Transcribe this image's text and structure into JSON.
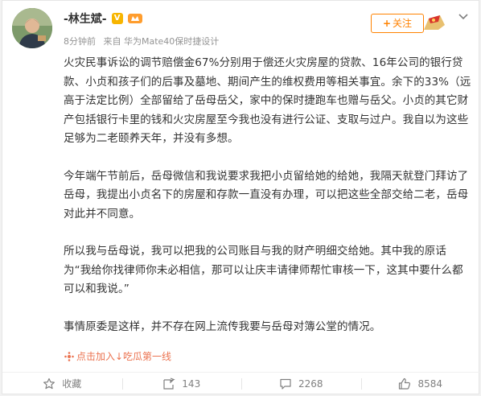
{
  "post": {
    "author_name": "-林生斌-",
    "vip_badge": "V",
    "timestamp": "8分钟前",
    "source": "来自 华为Mate40保时捷设计",
    "follow_label": "关注",
    "paragraphs": [
      "火灾民事诉讼的调节赔偿金67%分别用于偿还火灾房屋的贷款、16年公司的银行贷款、小贞和孩子们的后事及墓地、期间产生的维权费用等相关事宜。余下的33%（远高于法定比例）全部留给了岳母岳父，家中的保时捷跑车也赠与岳父。小贞的其它财产包括银行卡里的钱和火灾房屋至今我也没有进行公证、支取与过户。我自以为这些足够为二老颐养天年，并没有多想。",
      "今年端午节前后，岳母微信和我说要求我把小贞留给她的给她，我隔天就登门拜访了岳母，我提出小贞名下的房屋和存款一直没有办理，可以把这些全部交给二老，岳母对此并不同意。",
      "所以我与岳母说，我可以把我的公司账目与我的财产明细交给她。其中我的原话为“我给你找律师你未必相信，那可以让庆丰请律师帮忙审核一下，这其中要什么都可以和我说。”",
      "事情原委是这样，并不存在网上流传我要与岳母对簿公堂的情况。"
    ],
    "super_topic": "点击加入↓吃瓜第一线"
  },
  "actions": {
    "favorite_label": "收藏",
    "repost_count": "143",
    "comment_count": "2268",
    "like_count": "8584"
  },
  "colors": {
    "accent": "#ff8200",
    "topic": "#eb7350",
    "muted": "#939393"
  },
  "icons": [
    "avatar",
    "vip-icon",
    "level-badge-icon",
    "chevron-down-icon",
    "topic-icon",
    "star-icon",
    "repost-icon",
    "comment-icon",
    "like-icon"
  ]
}
